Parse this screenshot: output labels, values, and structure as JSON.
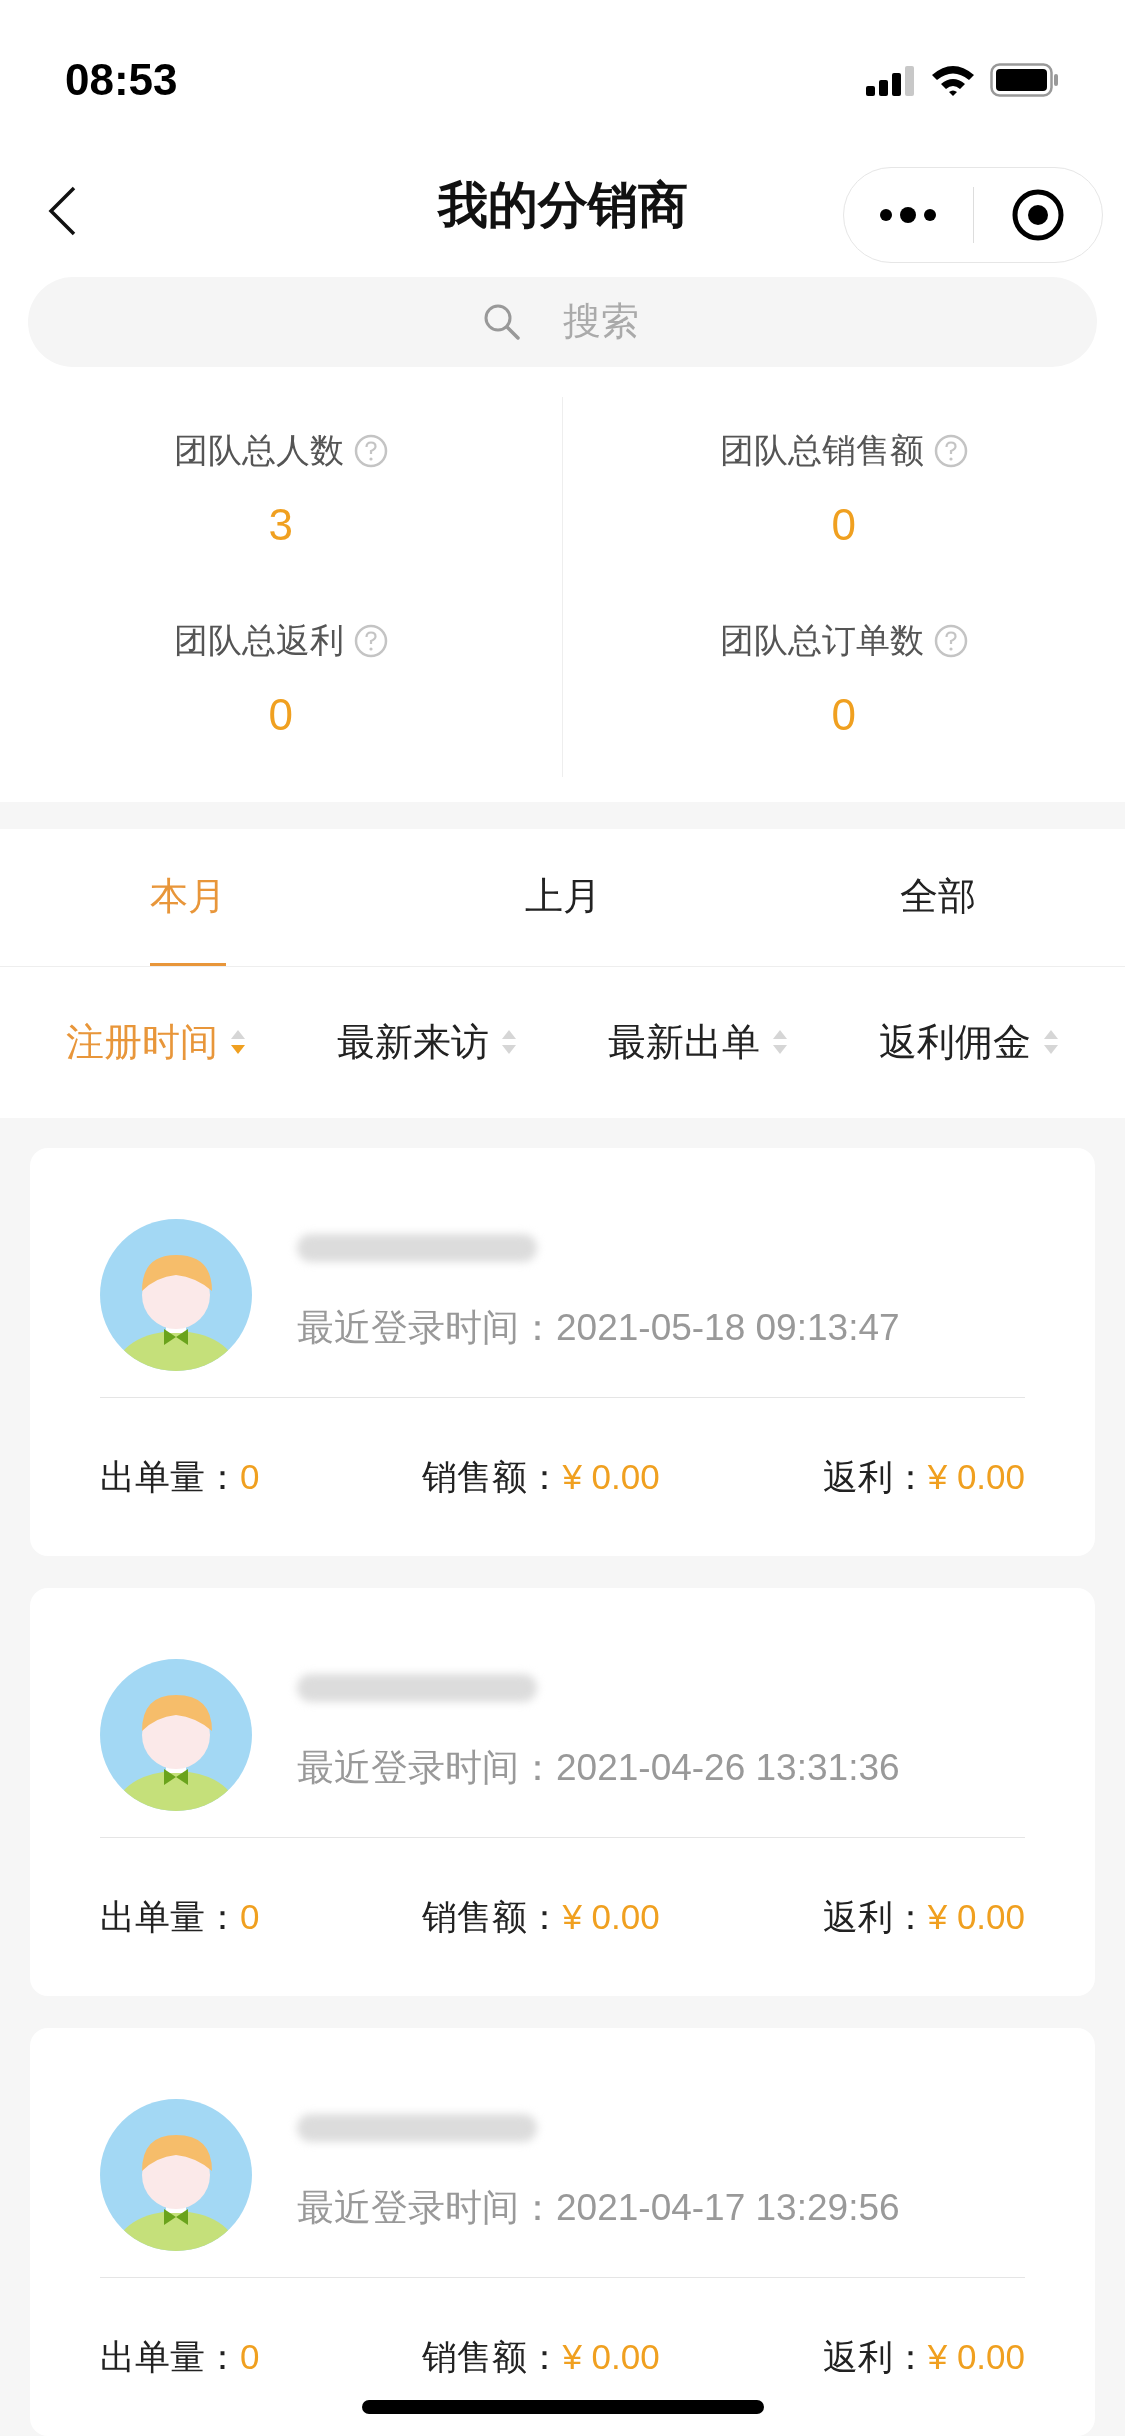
{
  "status_bar": {
    "time": "08:53"
  },
  "nav": {
    "title": "我的分销商"
  },
  "search": {
    "placeholder": "搜索"
  },
  "stats": [
    {
      "label": "团队总人数",
      "value": "3"
    },
    {
      "label": "团队总销售额",
      "value": "0"
    },
    {
      "label": "团队总返利",
      "value": "0"
    },
    {
      "label": "团队总订单数",
      "value": "0"
    }
  ],
  "tabs": [
    {
      "label": "本月",
      "selected": true
    },
    {
      "label": "上月",
      "selected": false
    },
    {
      "label": "全部",
      "selected": false
    }
  ],
  "sort_options": [
    {
      "label": "注册时间",
      "selected": true
    },
    {
      "label": "最新来访",
      "selected": false
    },
    {
      "label": "最新出单",
      "selected": false
    },
    {
      "label": "返利佣金",
      "selected": false
    }
  ],
  "members": [
    {
      "login_label": "最近登录时间：",
      "login_time": "2021-05-18 09:13:47",
      "orders_label": "出单量：",
      "orders": "0",
      "sales_label": "销售额：",
      "sales": "¥ 0.00",
      "rebate_label": "返利：",
      "rebate": "¥ 0.00"
    },
    {
      "login_label": "最近登录时间：",
      "login_time": "2021-04-26 13:31:36",
      "orders_label": "出单量：",
      "orders": "0",
      "sales_label": "销售额：",
      "sales": "¥ 0.00",
      "rebate_label": "返利：",
      "rebate": "¥ 0.00"
    },
    {
      "login_label": "最近登录时间：",
      "login_time": "2021-04-17 13:29:56",
      "orders_label": "出单量：",
      "orders": "0",
      "sales_label": "销售额：",
      "sales": "¥ 0.00",
      "rebate_label": "返利：",
      "rebate": "¥ 0.00"
    }
  ]
}
